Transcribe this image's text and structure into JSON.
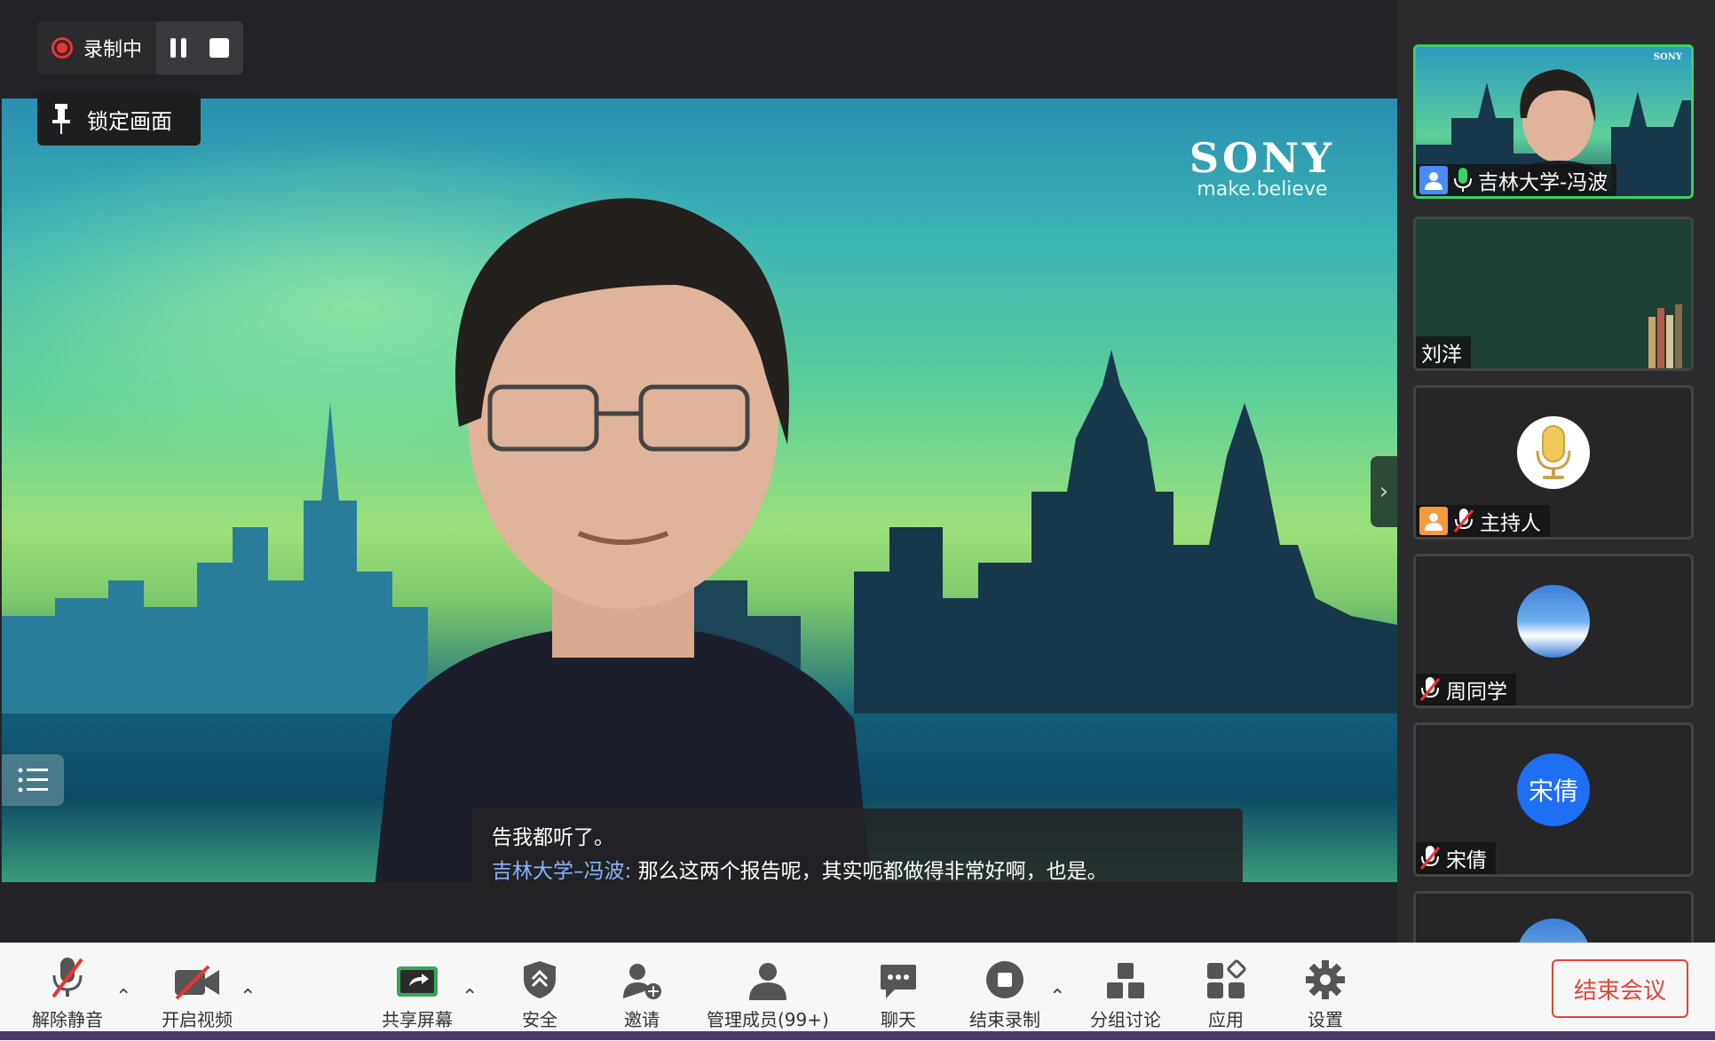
{
  "recording": {
    "label": "录制中"
  },
  "lock_view": {
    "label": "锁定画面"
  },
  "video": {
    "brand": "SONY",
    "tagline": "make.believe"
  },
  "subtitle": {
    "line1": "告我都听了。",
    "speaker": "吉林大学–冯波:",
    "text": "那么这两个报告呢，其实呃都做得非常好啊，也是。"
  },
  "participants": [
    {
      "name": "吉林大学-冯波"
    },
    {
      "name": "刘洋"
    },
    {
      "name": "主持人"
    },
    {
      "name": "周同学"
    },
    {
      "name": "宋倩",
      "avatar_text": "宋倩"
    }
  ],
  "toolbar": {
    "unmute": "解除静音",
    "start_video": "开启视频",
    "share_screen": "共享屏幕",
    "security": "安全",
    "invite": "邀请",
    "manage_members": "管理成员(99+)",
    "chat": "聊天",
    "stop_recording": "结束录制",
    "breakout": "分组讨论",
    "apps": "应用",
    "settings": "设置",
    "end_meeting": "结束会议"
  },
  "colors": {
    "active_border": "#3cd06a",
    "end_red": "#e0463a",
    "host_blue": "#4a8cf7",
    "rec_red": "#ee3333"
  }
}
